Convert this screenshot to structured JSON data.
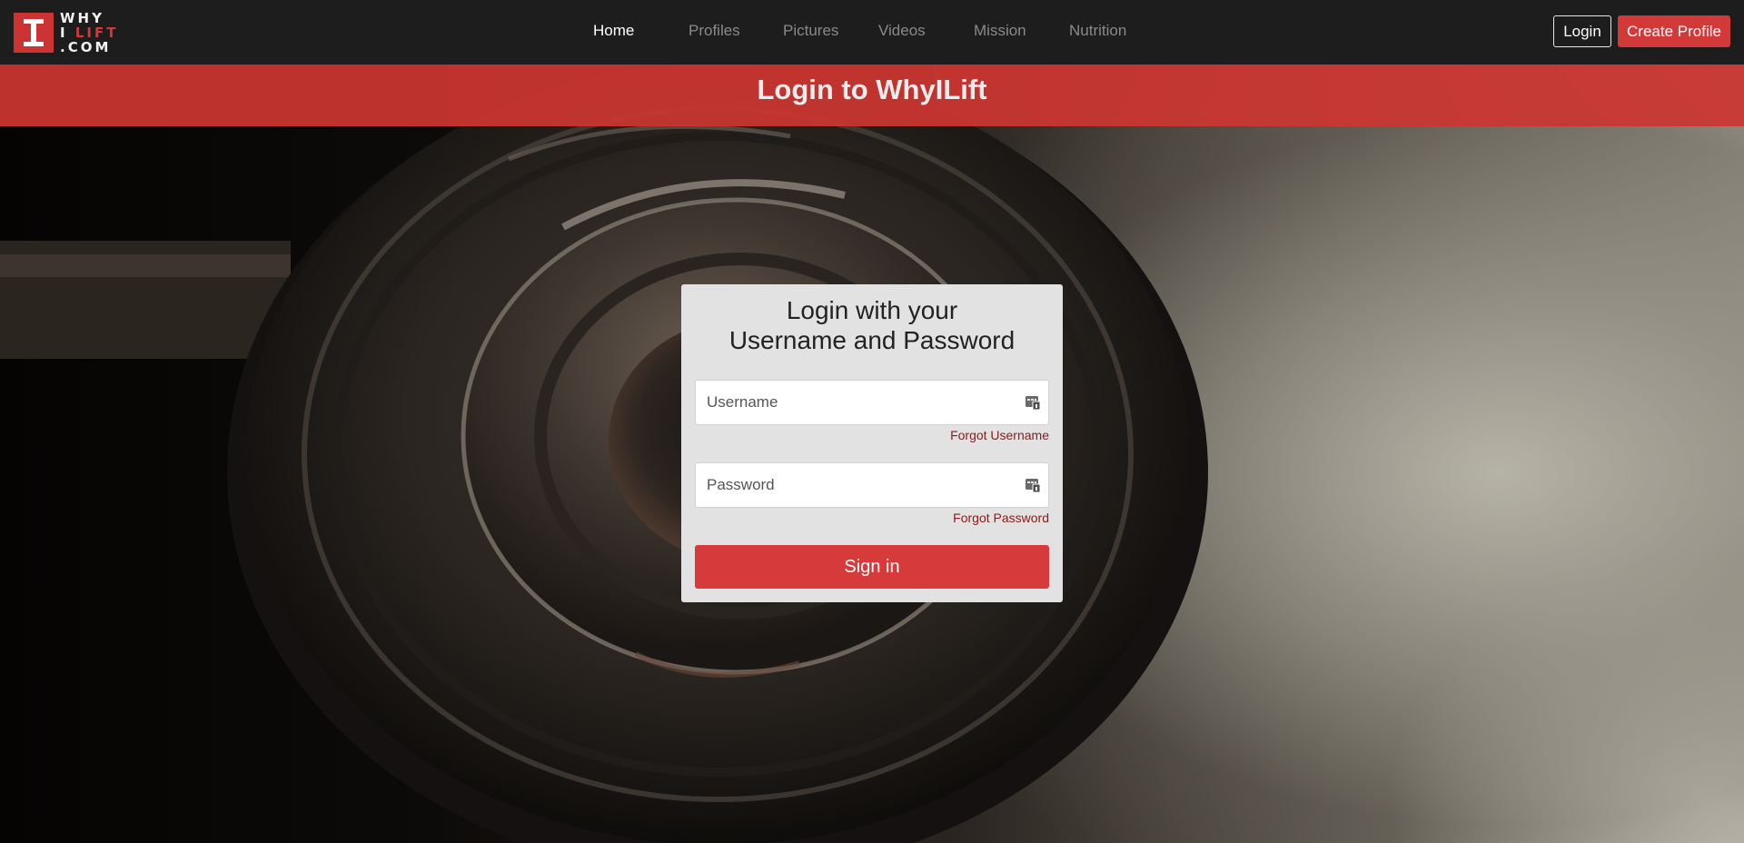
{
  "brand": {
    "logo_line1": "WHY",
    "logo_line2": "I LIFT",
    "logo_line2_a": "I",
    "logo_line2_b": "LIFT",
    "logo_line3": ".COM",
    "color_red": "#d23a3a"
  },
  "nav": {
    "items": [
      {
        "label": "Home",
        "active": true
      },
      {
        "label": "Profiles",
        "active": false
      },
      {
        "label": "Pictures",
        "active": false
      },
      {
        "label": "Videos",
        "active": false
      },
      {
        "label": "Mission",
        "active": false
      },
      {
        "label": "Nutrition",
        "active": false
      }
    ],
    "login_label": "Login",
    "create_profile_label": "Create Profile"
  },
  "header": {
    "title": "Login to WhyILift"
  },
  "login_card": {
    "title_line1": "Login with your",
    "title_line2": "Username and Password",
    "username": {
      "placeholder": "Username",
      "value": "",
      "icon": "id-card-icon"
    },
    "forgot_username": "Forgot Username",
    "password": {
      "placeholder": "Password",
      "value": "",
      "icon": "id-card-icon"
    },
    "forgot_password": "Forgot Password",
    "signin_label": "Sign in"
  },
  "colors": {
    "navbar_bg": "#1d1d1d",
    "accent_red": "#d63a3a",
    "card_bg": "#e2e2e2",
    "link_dark_red": "#8b1a1a"
  }
}
